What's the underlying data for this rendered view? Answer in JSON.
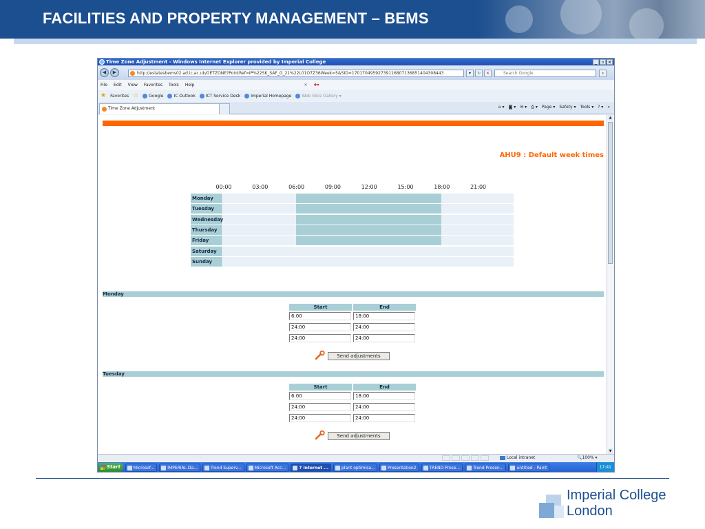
{
  "slide": {
    "title": "FACILITIES AND PROPERTY MANAGEMENT – BEMS",
    "logo_line1": "Imperial College",
    "logo_line2": "London",
    "brand_color": "#1c4f8f"
  },
  "browser": {
    "window_title": "Time Zone Adjustment - Windows Internet Explorer provided by Imperial College",
    "address": "http://estatesbems02.ad.ic.ac.uk/GETZONE?PointRef=IP%22SK_SAF_G_21%22L01O7Z36Week=5&SID=17017049592739116807136851404308443",
    "search_placeholder": "Search Google",
    "menu": [
      "File",
      "Edit",
      "View",
      "Favorites",
      "Tools",
      "Help"
    ],
    "favorites_label": "Favorites",
    "favorites": [
      "Google",
      "IC Outlook",
      "ICT Service Desk",
      "Imperial Homepage",
      "Web Slice Gallery"
    ],
    "tab_title": "Time Zone Adjustment",
    "command_bar": [
      "Page",
      "Safety",
      "Tools"
    ],
    "status_zone": "Local intranet",
    "zoom": "100%"
  },
  "page": {
    "accent_color": "#ff6600",
    "schedule_title": "AHU9 : Default week times",
    "hours": [
      "00:00",
      "03:00",
      "06:00",
      "09:00",
      "12:00",
      "15:00",
      "18:00",
      "21:00"
    ],
    "days": [
      {
        "name": "Monday",
        "on": [
          6,
          18
        ]
      },
      {
        "name": "Tuesday",
        "on": [
          6,
          18
        ]
      },
      {
        "name": "Wednesday",
        "on": [
          6,
          18
        ]
      },
      {
        "name": "Thursday",
        "on": [
          6,
          18
        ]
      },
      {
        "name": "Friday",
        "on": [
          6,
          18
        ]
      },
      {
        "name": "Saturday",
        "on": null
      },
      {
        "name": "Sunday",
        "on": null
      }
    ],
    "start_label": "Start",
    "end_label": "End",
    "send_label": "Send adjustments",
    "editors": [
      {
        "day": "Monday",
        "rows": [
          [
            "6:00",
            "18:00"
          ],
          [
            "24:00",
            "24:00"
          ],
          [
            "24:00",
            "24:00"
          ]
        ]
      },
      {
        "day": "Tuesday",
        "rows": [
          [
            "6:00",
            "18:00"
          ],
          [
            "24:00",
            "24:00"
          ],
          [
            "24:00",
            "24:00"
          ]
        ]
      }
    ]
  },
  "taskbar": {
    "start": "Start",
    "items": [
      "Microsof...",
      "IMPERIAL Da...",
      "Trend Superv...",
      "Microsoft Acc...",
      "7 Internet ...",
      "plant optimisa...",
      "Presentation2",
      "TREND Prese...",
      "Trend Presen...",
      "untitled - Paint"
    ],
    "active_index": 4,
    "clock": "17:41"
  }
}
